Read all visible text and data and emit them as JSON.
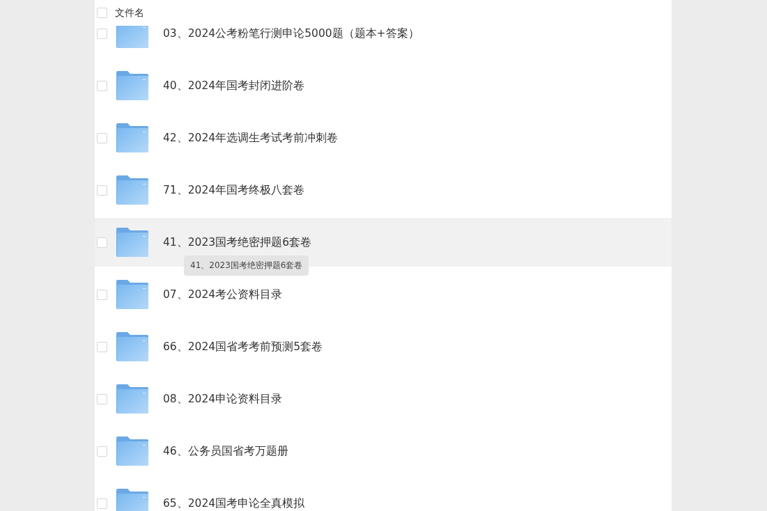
{
  "header": {
    "label": "文件名",
    "checked": false
  },
  "files": [
    {
      "name": "03、2024公考粉笔行测申论5000题（题本+答案）",
      "checked": false,
      "hovered": false
    },
    {
      "name": "40、2024年国考封闭进阶卷",
      "checked": false,
      "hovered": false
    },
    {
      "name": "42、2024年选调生考试考前冲刺卷",
      "checked": false,
      "hovered": false
    },
    {
      "name": "71、2024年国考终极八套卷",
      "checked": false,
      "hovered": false
    },
    {
      "name": "41、2023国考绝密押题6套卷",
      "checked": false,
      "hovered": true,
      "tooltip": "41、2023国考绝密押题6套卷"
    },
    {
      "name": "07、2024考公资料目录",
      "checked": false,
      "hovered": false
    },
    {
      "name": "66、2024国省考考前预测5套卷",
      "checked": false,
      "hovered": false
    },
    {
      "name": "08、2024申论资料目录",
      "checked": false,
      "hovered": false
    },
    {
      "name": "46、公务员国省考万题册",
      "checked": false,
      "hovered": false
    },
    {
      "name": "65、2024国考申论全真模拟",
      "checked": false,
      "hovered": false
    }
  ]
}
